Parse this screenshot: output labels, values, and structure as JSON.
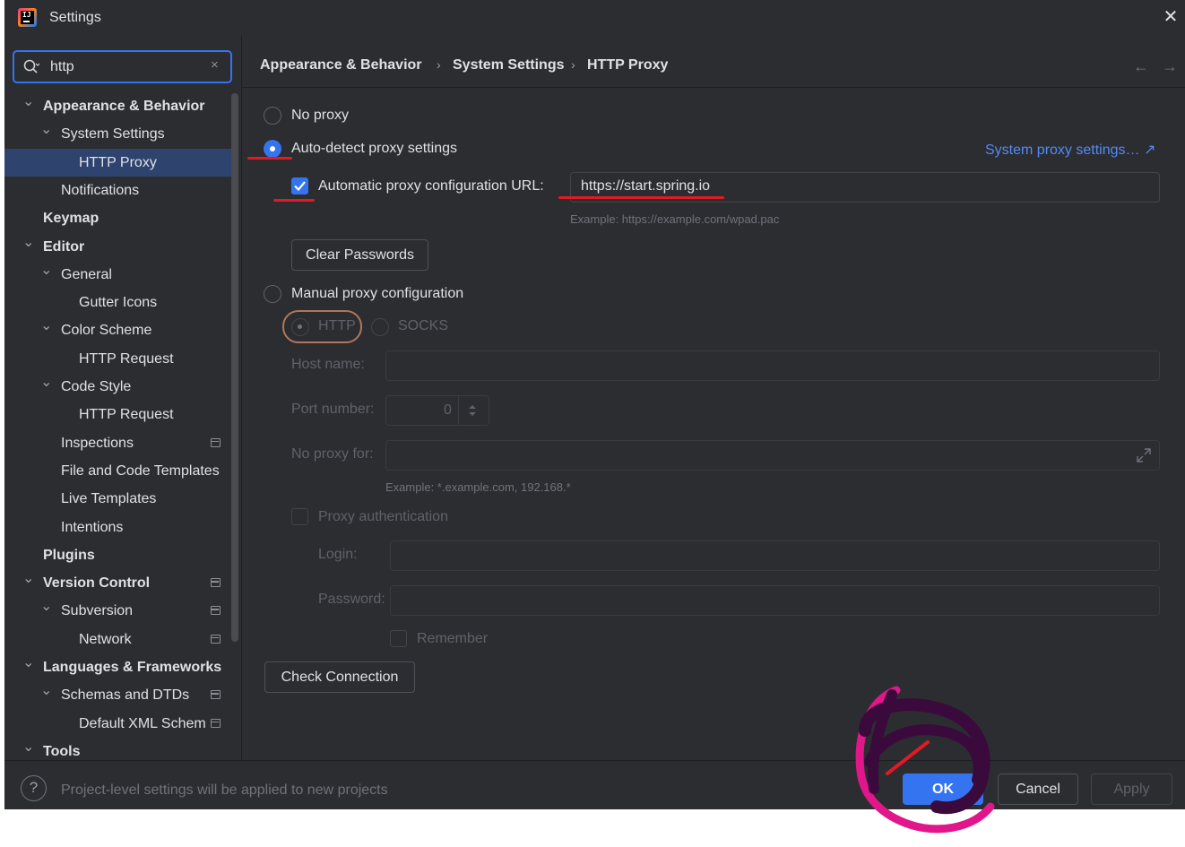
{
  "window": {
    "title": "Settings",
    "close_icon": "close-icon"
  },
  "search": {
    "value": "http",
    "clear_glyph": "×"
  },
  "tree": [
    {
      "label": "Appearance & Behavior",
      "level": 0,
      "bold": true,
      "expanded": true,
      "project": false
    },
    {
      "label": "System Settings",
      "level": 1,
      "bold": false,
      "expanded": true,
      "project": false
    },
    {
      "label": "HTTP Proxy",
      "level": 2,
      "bold": false,
      "selected": true,
      "project": false
    },
    {
      "label": "Notifications",
      "level": 1,
      "bold": false,
      "project": false
    },
    {
      "label": "Keymap",
      "level": 0,
      "bold": true,
      "project": false
    },
    {
      "label": "Editor",
      "level": 0,
      "bold": true,
      "expanded": true,
      "project": false
    },
    {
      "label": "General",
      "level": 1,
      "bold": false,
      "expanded": true,
      "project": false
    },
    {
      "label": "Gutter Icons",
      "level": 2,
      "bold": false,
      "project": false
    },
    {
      "label": "Color Scheme",
      "level": 1,
      "bold": false,
      "expanded": true,
      "project": false
    },
    {
      "label": "HTTP Request",
      "level": 2,
      "bold": false,
      "project": false
    },
    {
      "label": "Code Style",
      "level": 1,
      "bold": false,
      "expanded": true,
      "project": false
    },
    {
      "label": "HTTP Request",
      "level": 2,
      "bold": false,
      "project": false
    },
    {
      "label": "Inspections",
      "level": 1,
      "bold": false,
      "project": true
    },
    {
      "label": "File and Code Templates",
      "level": 1,
      "bold": false,
      "project": false
    },
    {
      "label": "Live Templates",
      "level": 1,
      "bold": false,
      "project": false
    },
    {
      "label": "Intentions",
      "level": 1,
      "bold": false,
      "project": false
    },
    {
      "label": "Plugins",
      "level": 0,
      "bold": true,
      "project": false
    },
    {
      "label": "Version Control",
      "level": 0,
      "bold": true,
      "expanded": true,
      "project": true
    },
    {
      "label": "Subversion",
      "level": 1,
      "bold": false,
      "expanded": true,
      "project": true
    },
    {
      "label": "Network",
      "level": 2,
      "bold": false,
      "project": true
    },
    {
      "label": "Languages & Frameworks",
      "level": 0,
      "bold": true,
      "expanded": true,
      "project": false
    },
    {
      "label": "Schemas and DTDs",
      "level": 1,
      "bold": false,
      "expanded": true,
      "project": true
    },
    {
      "label": "Default XML Schem",
      "level": 2,
      "bold": false,
      "project": true
    },
    {
      "label": "Tools",
      "level": 0,
      "bold": true,
      "expanded": true,
      "project": false
    }
  ],
  "breadcrumb": {
    "items": [
      "Appearance & Behavior",
      "System Settings",
      "HTTP Proxy"
    ],
    "sep": "›",
    "back": "←",
    "forward": "→"
  },
  "proxy": {
    "no_proxy_label": "No proxy",
    "auto_detect_label": "Auto-detect proxy settings",
    "system_proxy_link": "System proxy settings… ↗",
    "auto_url_label": "Automatic proxy configuration URL:",
    "auto_url_value": "https://start.spring.io",
    "auto_url_example": "Example: https://example.com/wpad.pac",
    "clear_passwords": "Clear Passwords",
    "manual_label": "Manual proxy configuration",
    "http_label": "HTTP",
    "socks_label": "SOCKS",
    "host_label": "Host name:",
    "port_label": "Port number:",
    "port_value": "0",
    "no_proxy_for_label": "No proxy for:",
    "no_proxy_example": "Example: *.example.com, 192.168.*",
    "auth_label": "Proxy authentication",
    "login_label": "Login:",
    "password_label": "Password:",
    "remember_label": "Remember",
    "check_connection": "Check Connection",
    "selected_mode": "auto-detect",
    "auto_url_checked": true
  },
  "footer": {
    "help": "?",
    "note": "Project-level settings will be applied to new projects",
    "ok": "OK",
    "cancel": "Cancel",
    "apply": "Apply"
  },
  "colors": {
    "accent": "#3574f0",
    "background": "#2b2d30",
    "link": "#548af7",
    "annotation_red": "#e01b24",
    "annotation_purple": "#3a0a3c",
    "annotation_magenta": "#e0168a"
  }
}
